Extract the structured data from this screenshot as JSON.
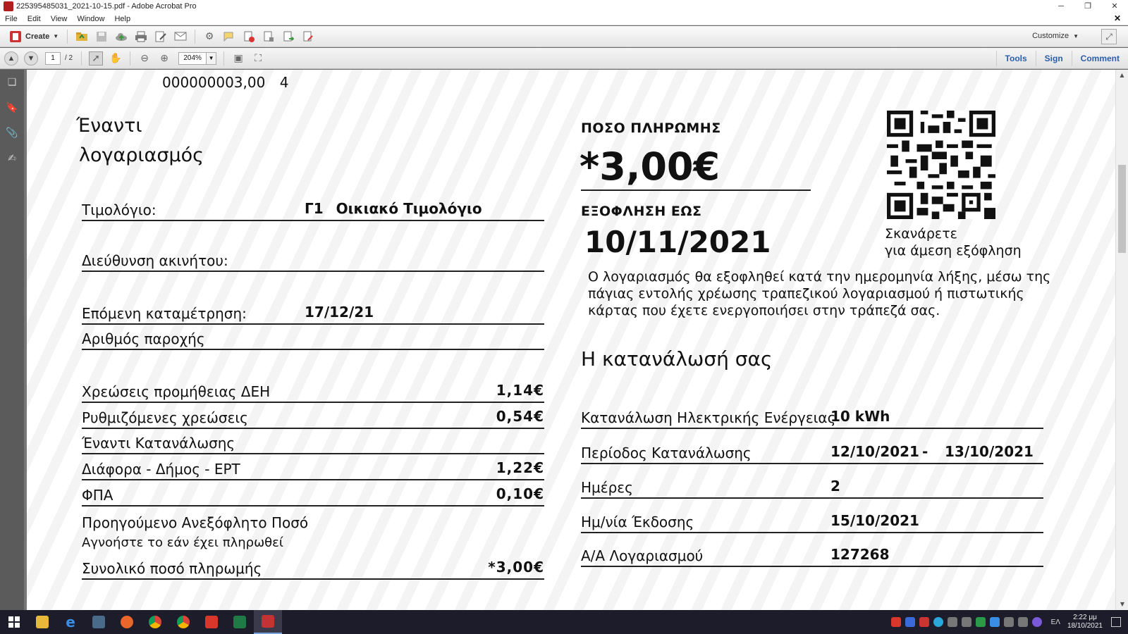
{
  "window": {
    "title": "225395485031_2021-10-15.pdf - Adobe Acrobat Pro",
    "minimize": "─",
    "restore": "❐",
    "close": "✕"
  },
  "menu": [
    "File",
    "Edit",
    "View",
    "Window",
    "Help"
  ],
  "menu_close": "✕",
  "toolbar": {
    "create_label": "Create",
    "customize_label": "Customize"
  },
  "navbar": {
    "page_current": "1",
    "page_total": "/ 2",
    "zoom": "204%"
  },
  "right_tabs": [
    "Tools",
    "Sign",
    "Comment"
  ],
  "document": {
    "top_line_number": "000000003,00",
    "top_line_digit": "4",
    "title_line1": "Έναντι",
    "title_line2": "λογαριασμός",
    "invoice_label": "Τιμολόγιο:",
    "invoice_code": "Γ1",
    "invoice_type": "Οικιακό  Τιμολόγιο",
    "address_label": "Διεύθυνση ακινήτου:",
    "next_reading_label": "Επόμενη καταμέτρηση:",
    "next_reading_value": "17/12/21",
    "supply_number_label": "Αριθμός παροχής",
    "charges": [
      {
        "label": "Χρεώσεις προμήθειας ΔΕΗ",
        "amount": "1,14€"
      },
      {
        "label": "Ρυθμιζόμενες χρεώσεις",
        "amount": "0,54€"
      },
      {
        "label": "Έναντι Κατανάλωσης",
        "amount": ""
      },
      {
        "label": "Διάφορα - Δήμος - ΕΡΤ",
        "amount": "1,22€"
      },
      {
        "label": "ΦΠΑ",
        "amount": "0,10€"
      }
    ],
    "previous_unpaid_label": "Προηγούμενο Ανεξόφλητο Ποσό",
    "previous_unpaid_note": "Αγνοήστε το εάν έχει πληρωθεί",
    "total_label": "Συνολικό ποσό πληρωμής",
    "total_amount": "*3,00€",
    "payment_amount_label": "ΠΟΣΟ ΠΛΗΡΩΜΗΣ",
    "payment_amount": "*3,00€",
    "due_label": "ΕΞΟΦΛΗΣΗ ΕΩΣ",
    "due_date": "10/11/2021",
    "qr_caption_line1": "Σκανάρετε",
    "qr_caption_line2": "για άμεση εξόφληση",
    "payment_note": "Ο λογαριασμός θα εξοφληθεί κατά την ημερομηνία λήξης, μέσω της πάγιας εντολής χρέωσης τραπεζικού λογαριασμού ή πιστωτικής κάρτας που έχετε ενεργοποιήσει στην τράπεζά σας.",
    "consumption_title": "Η κατανάλωσή σας",
    "consumption": {
      "energy_label": "Κατανάλωση Ηλεκτρικής Ενέργειας",
      "energy_value": "10 kWh",
      "period_label": "Περίοδος Κατανάλωσης",
      "period_from": "12/10/2021",
      "period_sep": "-",
      "period_to": "13/10/2021",
      "days_label": "Ημέρες",
      "days_value": "2",
      "issue_label": "Ημ/νία Έκδοσης",
      "issue_value": "15/10/2021",
      "account_label": "Α/Α Λογαριασμού",
      "account_value": "127268"
    }
  },
  "taskbar": {
    "language": "ΕΛ",
    "time": "2:22 μμ",
    "date": "18/10/2021"
  },
  "colors": {
    "accent_blue": "#2c5ea8",
    "acrobat_red": "#c33333",
    "taskbar": "#1c1c2a"
  }
}
